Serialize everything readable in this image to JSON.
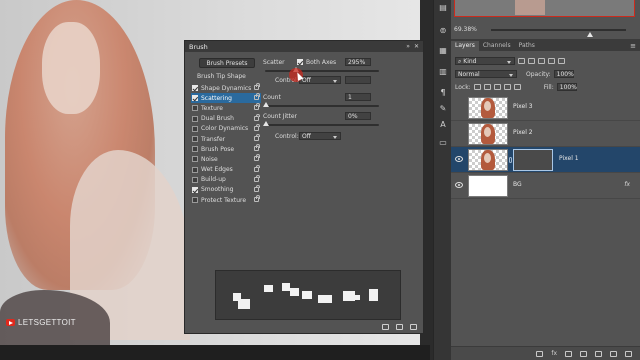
{
  "brand": {
    "text": "LETSGETTOIT"
  },
  "brush_panel": {
    "title": "Brush",
    "presets_button": "Brush Presets",
    "tip_shape": "Brush Tip Shape",
    "options": [
      {
        "label": "Shape Dynamics",
        "checked": true,
        "selected": false
      },
      {
        "label": "Scattering",
        "checked": true,
        "selected": true
      },
      {
        "label": "Texture",
        "checked": false,
        "selected": false
      },
      {
        "label": "Dual Brush",
        "checked": false,
        "selected": false
      },
      {
        "label": "Color Dynamics",
        "checked": false,
        "selected": false
      },
      {
        "label": "Transfer",
        "checked": false,
        "selected": false
      },
      {
        "label": "Brush Pose",
        "checked": false,
        "selected": false
      },
      {
        "label": "Noise",
        "checked": false,
        "selected": false
      },
      {
        "label": "Wet Edges",
        "checked": false,
        "selected": false
      },
      {
        "label": "Build-up",
        "checked": false,
        "selected": false
      },
      {
        "label": "Smoothing",
        "checked": true,
        "selected": false
      },
      {
        "label": "Protect Texture",
        "checked": false,
        "selected": false
      }
    ],
    "scatter_label": "Scatter",
    "both_axes_label": "Both Axes",
    "scatter_value": "295%",
    "control_label": "Control:",
    "control_value": "Off",
    "count_label": "Count",
    "count_value": "1",
    "count_jitter_label": "Count Jitter",
    "count_jitter_value": "0%",
    "control2_label": "Control:",
    "control2_value": "Off"
  },
  "navigator": {
    "zoom": "69.38%"
  },
  "layers_panel": {
    "tabs": [
      "Layers",
      "Channels",
      "Paths"
    ],
    "active_tab": "Layers",
    "filter_value": "Kind",
    "blend_mode": "Normal",
    "opacity_label": "Opacity:",
    "opacity_value": "100%",
    "lock_label": "Lock:",
    "fill_label": "Fill:",
    "fill_value": "100%",
    "layers": [
      {
        "name": "Pixel 3",
        "selected": false,
        "visible": false
      },
      {
        "name": "Pixel 2",
        "selected": false,
        "visible": false
      },
      {
        "name": "Pixel 1",
        "selected": true,
        "visible": true,
        "has_mask": true
      },
      {
        "name": "BG",
        "selected": false,
        "visible": true,
        "white": true,
        "fx": "fx"
      }
    ],
    "footer_fx": "fx"
  },
  "colors": {
    "accent_selection": "#2a6a9e",
    "layer_selected": "#23466a",
    "cursor_highlight": "#c8281e"
  }
}
